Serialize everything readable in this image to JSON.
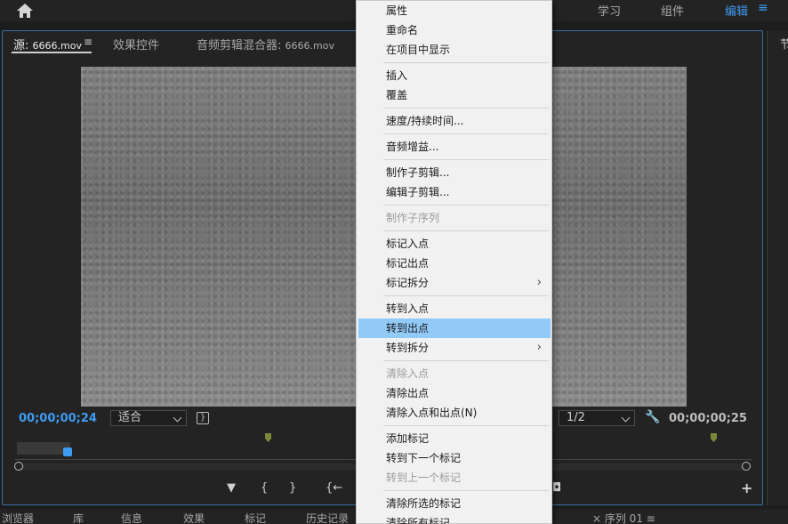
{
  "workspace": {
    "items": [
      {
        "label": "学习",
        "active": false
      },
      {
        "label": "组件",
        "active": false
      },
      {
        "label": "编辑",
        "active": true
      }
    ],
    "menu_icon": "≡"
  },
  "source_panel": {
    "tabs": [
      {
        "label": "源:",
        "sub": "6666.mov",
        "active": true
      },
      {
        "label": "效果控件",
        "active": false
      },
      {
        "label": "音频剪辑混合器:",
        "sub": "6666.mov",
        "active": false
      }
    ],
    "tab_menu": "≡",
    "timecode_in": "00;00;00;24",
    "timecode_out": "00;00;00;25",
    "fit_select": "适合",
    "resolution_select": "1/2",
    "transport": [
      "▼",
      "{",
      "}",
      "{←"
    ]
  },
  "right_panel": {
    "tab_label": "节"
  },
  "bottom_tabs": [
    {
      "label": "浏览器"
    },
    {
      "label": "库"
    },
    {
      "label": "信息"
    },
    {
      "label": "效果"
    },
    {
      "label": "标记"
    },
    {
      "label": "历史记录"
    },
    {
      "label": "× 序列 01 ≡"
    }
  ],
  "context_menu": {
    "items": [
      {
        "label": "属性",
        "disabled": false
      },
      {
        "label": "重命名",
        "disabled": false
      },
      {
        "label": "在项目中显示",
        "disabled": false
      },
      {
        "label": "插入",
        "disabled": false
      },
      {
        "label": "覆盖",
        "disabled": false
      },
      {
        "label": "速度/持续时间...",
        "disabled": false
      },
      {
        "label": "音频增益...",
        "disabled": false
      },
      {
        "label": "制作子剪辑...",
        "disabled": false
      },
      {
        "label": "编辑子剪辑...",
        "disabled": false
      },
      {
        "label": "制作子序列",
        "disabled": true
      },
      {
        "label": "标记入点",
        "disabled": false
      },
      {
        "label": "标记出点",
        "disabled": false
      },
      {
        "label": "标记拆分",
        "disabled": false,
        "submenu": true
      },
      {
        "label": "转到入点",
        "disabled": false
      },
      {
        "label": "转到出点",
        "disabled": false,
        "highlighted": true
      },
      {
        "label": "转到拆分",
        "disabled": false,
        "submenu": true
      },
      {
        "label": "清除入点",
        "disabled": true
      },
      {
        "label": "清除出点",
        "disabled": false
      },
      {
        "label": "清除入点和出点(N)",
        "disabled": false
      },
      {
        "label": "添加标记",
        "disabled": false
      },
      {
        "label": "转到下一个标记",
        "disabled": false
      },
      {
        "label": "转到上一个标记",
        "disabled": true
      },
      {
        "label": "清除所选的标记",
        "disabled": false
      },
      {
        "label": "清除所有标记",
        "disabled": false
      }
    ]
  },
  "colors": {
    "accent": "#3d9bf0",
    "highlight": "#91c9f7"
  }
}
